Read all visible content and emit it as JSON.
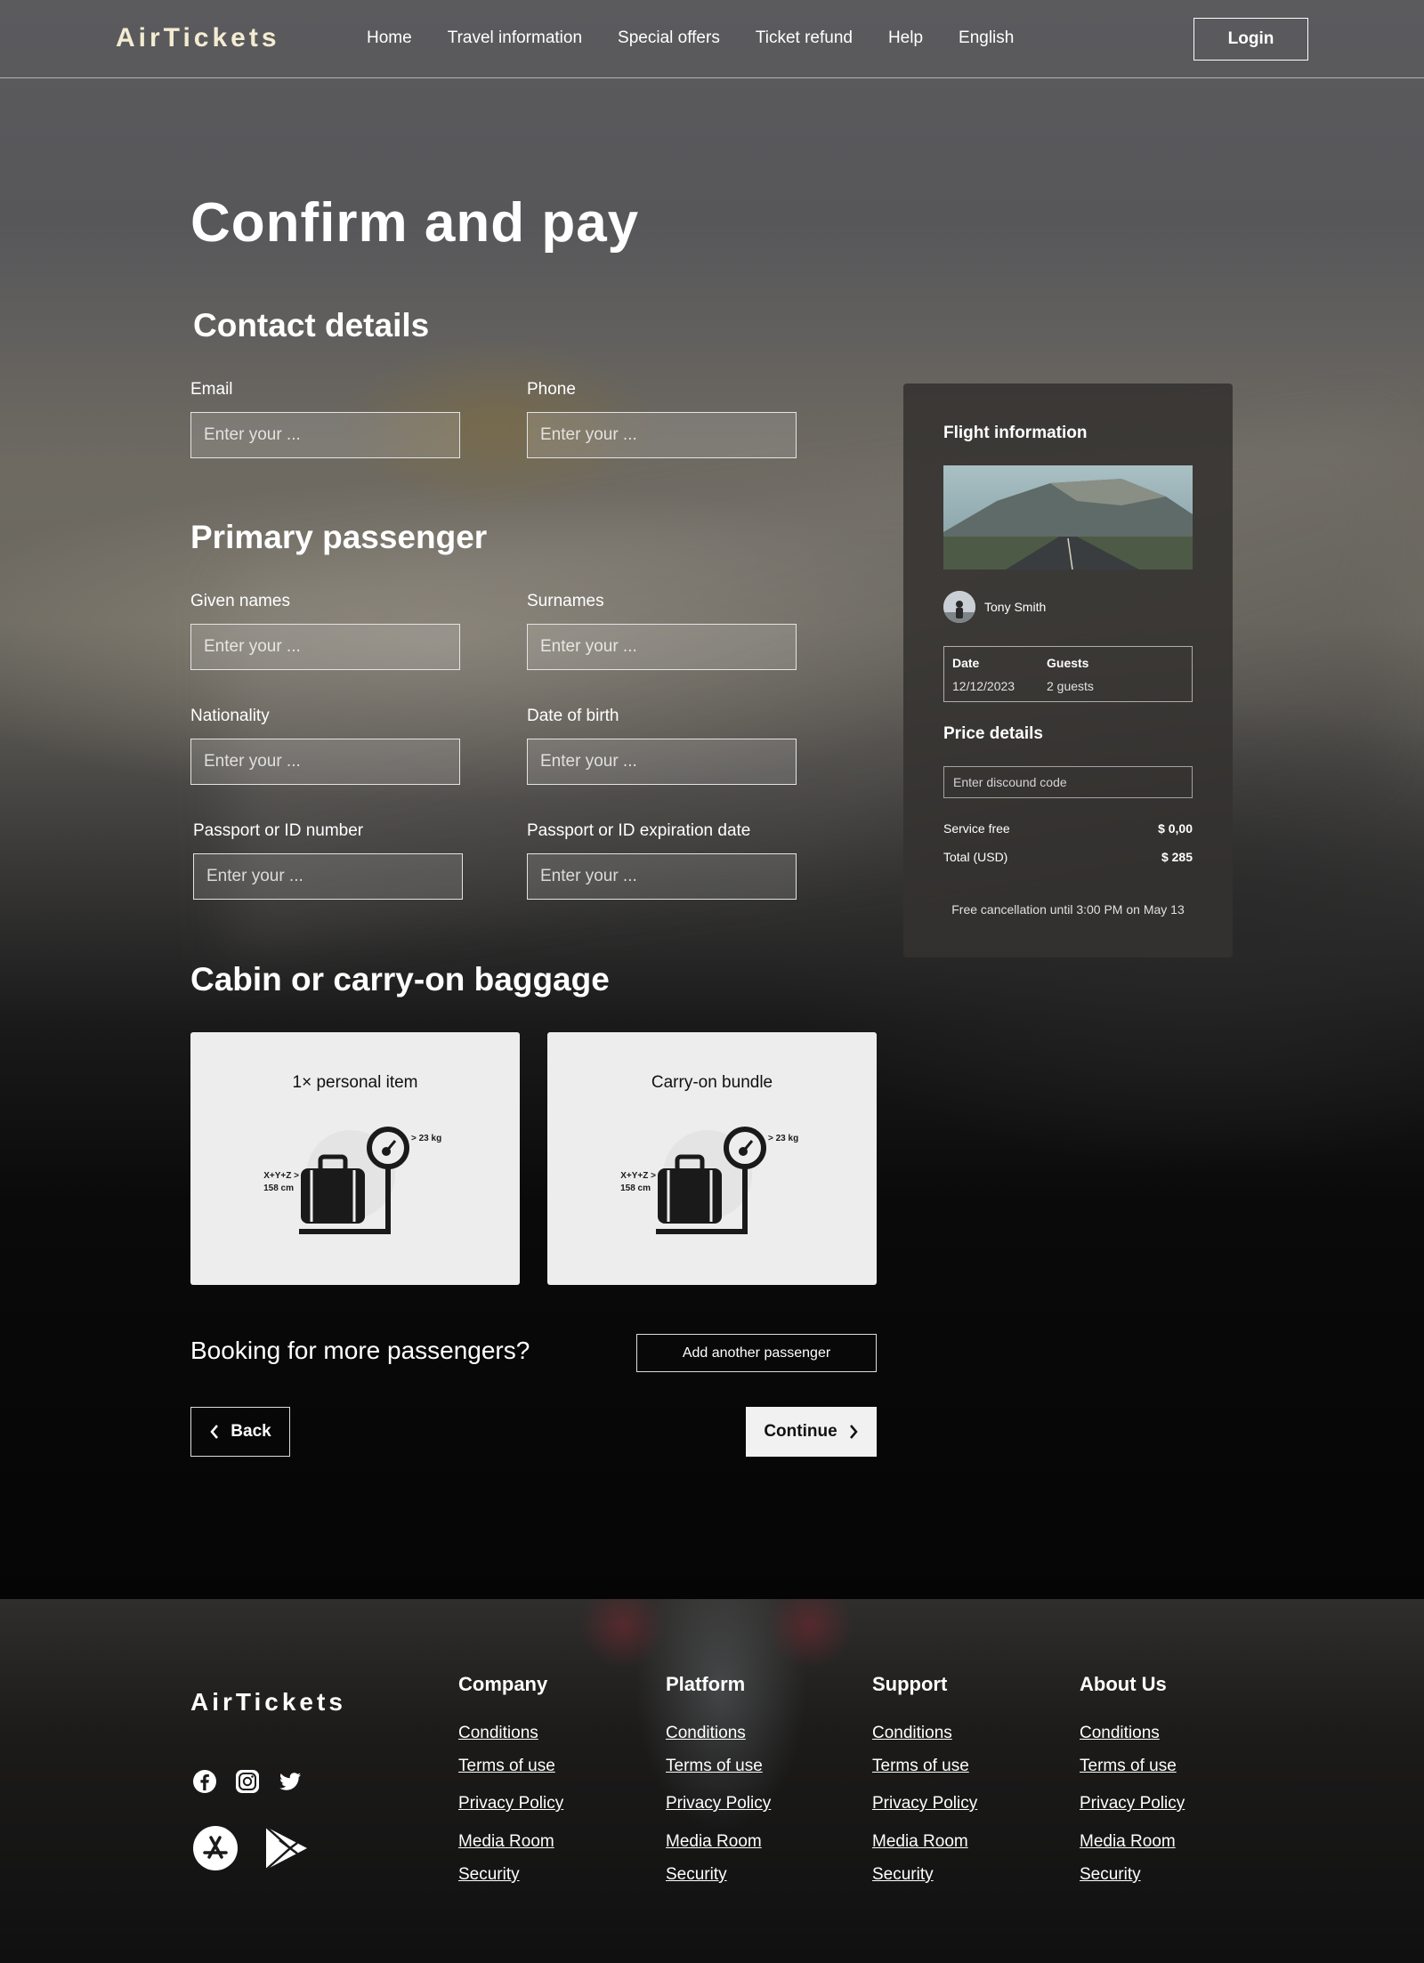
{
  "header": {
    "logo": "AirTickets",
    "nav": [
      "Home",
      "Travel information",
      "Special offers",
      "Ticket refund",
      "Help",
      "English"
    ],
    "login_label": "Login"
  },
  "page": {
    "title": "Confirm and pay"
  },
  "contact": {
    "title": "Contact details",
    "email_label": "Email",
    "email_placeholder": "Enter your ...",
    "phone_label": "Phone",
    "phone_placeholder": "Enter your ..."
  },
  "passenger": {
    "title": "Primary passenger",
    "given_label": "Given names",
    "given_placeholder": "Enter your ...",
    "surname_label": "Surnames",
    "surname_placeholder": "Enter your ...",
    "nationality_label": "Nationality",
    "nationality_placeholder": "Enter your ...",
    "dob_label": "Date of birth",
    "dob_placeholder": "Enter your ...",
    "passport_label": "Passport or ID number",
    "passport_placeholder": "Enter your ...",
    "expiry_label": "Passport or ID expiration date",
    "expiry_placeholder": "Enter your ..."
  },
  "baggage": {
    "title": "Cabin or carry-on baggage",
    "options": [
      {
        "title": "1× personal item",
        "weight": "> 23 kg",
        "dims_1": "X+Y+Z >",
        "dims_2": "158 cm"
      },
      {
        "title": "Carry-on bundle",
        "weight": "> 23 kg",
        "dims_1": "X+Y+Z >",
        "dims_2": "158 cm"
      }
    ]
  },
  "more": {
    "title": "Booking for more passengers?",
    "add_label": "Add another passenger"
  },
  "actions": {
    "back_label": "Back",
    "continue_label": "Continue"
  },
  "flight": {
    "title": "Flight information",
    "passenger_name": "Tony Smith",
    "date_label": "Date",
    "date_value": "12/12/2023",
    "guests_label": "Guests",
    "guests_value": "2 guests",
    "price_title": "Price details",
    "discount_placeholder": "Enter discound code",
    "service_label": "Service free",
    "service_value": "$ 0,00",
    "total_label": "Total (USD)",
    "total_value": "$ 285",
    "note": "Free cancellation until 3:00 PM on May 13"
  },
  "footer": {
    "logo": "AirTickets",
    "social_icons": [
      "facebook-icon",
      "instagram-icon",
      "twitter-icon"
    ],
    "app_icons": [
      "app-store-icon",
      "google-play-icon"
    ],
    "columns": [
      {
        "title": "Company",
        "links": [
          "Conditions",
          "Terms of use",
          "Privacy Policy",
          "Media Room",
          "Security"
        ]
      },
      {
        "title": "Platform",
        "links": [
          "Conditions",
          "Terms of use",
          "Privacy Policy",
          "Media Room",
          "Security"
        ]
      },
      {
        "title": "Support",
        "links": [
          "Conditions",
          "Terms of use",
          "Privacy Policy",
          "Media Room",
          "Security"
        ]
      },
      {
        "title": "About Us",
        "links": [
          "Conditions",
          "Terms of use",
          "Privacy Policy",
          "Media Room",
          "Security"
        ]
      }
    ]
  }
}
